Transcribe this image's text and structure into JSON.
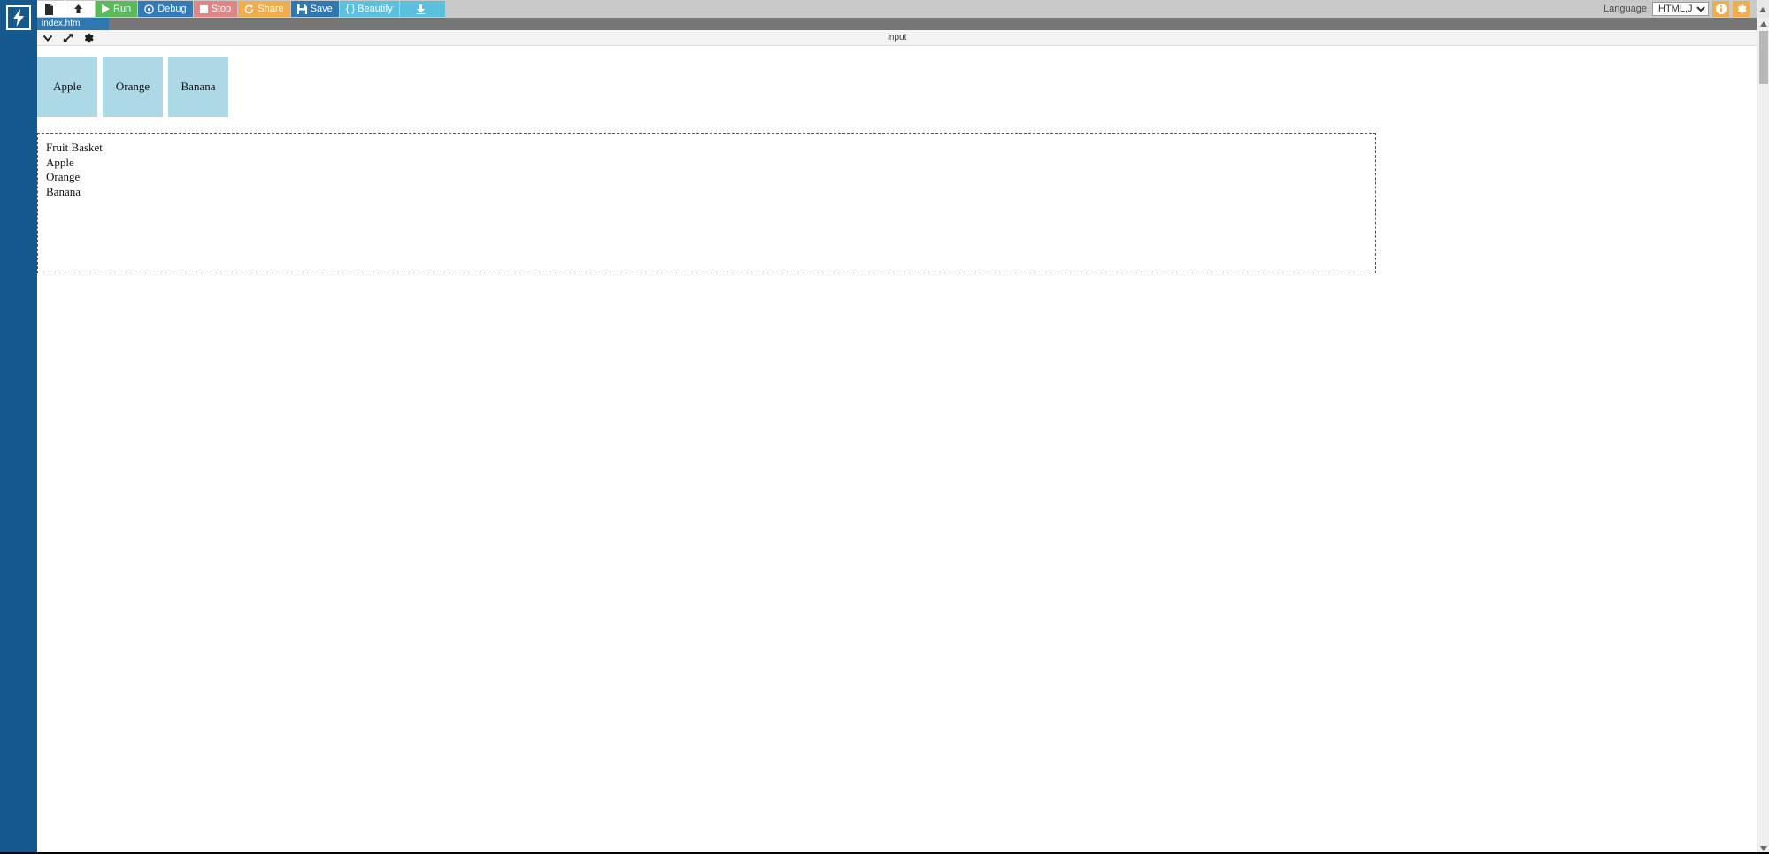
{
  "app": {
    "logo_icon": "lightning-bolt-icon"
  },
  "toolbar": {
    "buttons": [
      {
        "label": "",
        "icon": "new-file-icon",
        "name": "new-file-button"
      },
      {
        "label": "",
        "icon": "open-file-icon",
        "name": "open-file-button"
      },
      {
        "label": "Run",
        "icon": "play-icon",
        "name": "run-button"
      },
      {
        "label": "Debug",
        "icon": "debug-target-icon",
        "name": "debug-button"
      },
      {
        "label": "Stop",
        "icon": "stop-square-icon",
        "name": "stop-button"
      },
      {
        "label": "Share",
        "icon": "share-icon",
        "name": "share-button"
      },
      {
        "label": "Save",
        "icon": "floppy-disk-icon",
        "name": "save-button"
      },
      {
        "label": "{ } Beautify",
        "icon": "",
        "name": "beautify-button"
      },
      {
        "label": "",
        "icon": "download-icon",
        "name": "download-button"
      }
    ],
    "language_label": "Language",
    "language_value": "HTML,JS,C",
    "language_options": [
      "HTML,JS,CSS"
    ],
    "info_icon": "info-circle-icon",
    "settings_icon": "gear-icon"
  },
  "tabs": {
    "active_file": "index.html"
  },
  "preview": {
    "title": "input",
    "tools": [
      {
        "icon": "chevron-down-icon",
        "name": "collapse-toggle"
      },
      {
        "icon": "expand-diagonal-icon",
        "name": "expand-toggle"
      },
      {
        "icon": "gear-icon",
        "name": "preview-settings"
      }
    ],
    "cards": [
      {
        "label": "Apple"
      },
      {
        "label": "Orange"
      },
      {
        "label": "Banana"
      }
    ],
    "output_lines": [
      "Fruit Basket",
      "Apple",
      "Orange",
      "Banana"
    ]
  },
  "colors": {
    "rail": "#15598f",
    "run": "#5cb85c",
    "debug": "#337ab7",
    "stop": "#e08585",
    "share": "#f0ad4e",
    "save": "#2e77b0",
    "beautify": "#5bc0de",
    "card": "#add8e6",
    "tab_active": "#2e77b0",
    "tabstrip": "#767676"
  }
}
